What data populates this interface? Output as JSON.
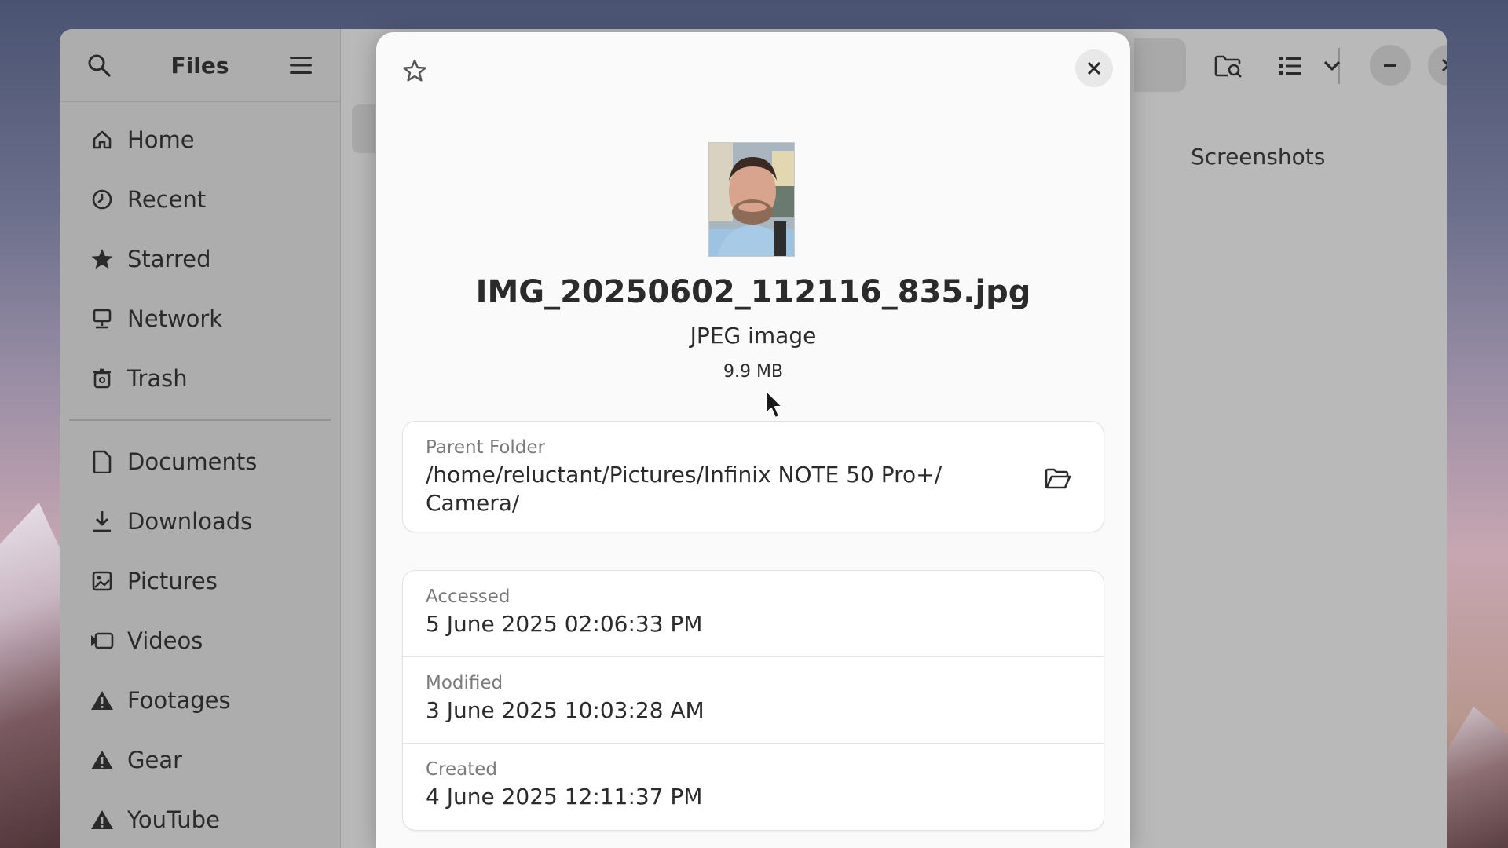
{
  "files_window": {
    "sidebar": {
      "title": "Files",
      "primary_items": [
        {
          "label": "Home",
          "icon": "home-icon"
        },
        {
          "label": "Recent",
          "icon": "recent-icon"
        },
        {
          "label": "Starred",
          "icon": "star-icon"
        },
        {
          "label": "Network",
          "icon": "network-icon"
        },
        {
          "label": "Trash",
          "icon": "trash-icon"
        }
      ],
      "bookmark_items": [
        {
          "label": "Documents",
          "icon": "document-icon"
        },
        {
          "label": "Downloads",
          "icon": "download-icon"
        },
        {
          "label": "Pictures",
          "icon": "picture-icon"
        },
        {
          "label": "Videos",
          "icon": "video-icon"
        },
        {
          "label": "Footages",
          "icon": "warning-icon"
        },
        {
          "label": "Gear",
          "icon": "warning-icon"
        },
        {
          "label": "YouTube",
          "icon": "warning-icon"
        }
      ]
    },
    "main": {
      "folder_item_label": "Screenshots"
    }
  },
  "properties_dialog": {
    "file_name": "IMG_20250602_112116_835.jpg",
    "file_type": "JPEG image",
    "file_size": "9.9 MB",
    "parent_folder": {
      "label": "Parent Folder",
      "value": "/home/reluctant/Pictures/Infinix NOTE 50 Pro+/ Camera/"
    },
    "dates": [
      {
        "label": "Accessed",
        "value": "5 June 2025 02:06:33 PM"
      },
      {
        "label": "Modified",
        "value": "3 June 2025 10:03:28 AM"
      },
      {
        "label": "Created",
        "value": "4 June 2025 12:11:37 PM"
      }
    ]
  },
  "colors": {
    "dialog_bg": "#fafafa",
    "card_bg": "#ffffff",
    "text_primary": "#2b2b2b",
    "text_secondary": "#7a7a7a",
    "dimmed_window": "#b9b9b9"
  }
}
